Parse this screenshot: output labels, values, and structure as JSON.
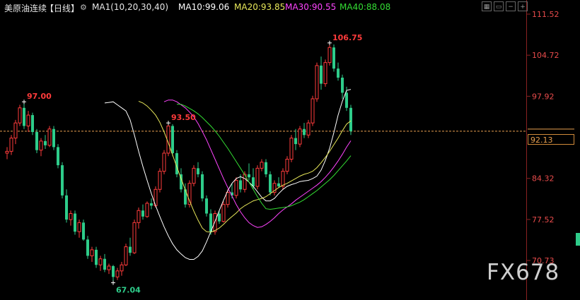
{
  "header": {
    "instrument": "美原油连续",
    "period": "【日线】",
    "settings_icon": "gear-icon",
    "ma_params": "MA1(10,20,30,40)",
    "ma10_label": "MA10:99.06",
    "ma20_label": "MA20:93.85",
    "ma30_label": "MA30:90.55",
    "ma40_label": "MA40:88.08"
  },
  "toolbar_icons": [
    "grid-icon",
    "window-icon",
    "minus-icon",
    "plus-icon"
  ],
  "watermark": "FX678",
  "colors": {
    "up": "#ff3b3b",
    "down": "#2ecc8a",
    "ma10": "#ffffff",
    "ma20": "#e8e85a",
    "ma30": "#ff44ff",
    "ma40": "#33dd33",
    "axis_text": "#e84b4b",
    "price_line": "#e8a050"
  },
  "chart_data": {
    "type": "candlestick",
    "title": "美原油连续【日线】",
    "ylim": [
      67.0,
      111.52
    ],
    "y_ticks": [
      "111.52",
      "104.72",
      "97.92",
      "92.13",
      "84.32",
      "77.52",
      "70.73"
    ],
    "current_price": "92.13",
    "annotations": [
      {
        "label": "97.00",
        "value": 97.0
      },
      {
        "label": "93.50",
        "value": 93.5
      },
      {
        "label": "106.75",
        "value": 106.75
      },
      {
        "label": "67.04",
        "value": 67.04
      }
    ],
    "ma_values": {
      "MA10": 99.06,
      "MA20": 93.85,
      "MA30": 90.55,
      "MA40": 88.08
    },
    "candles": [
      [
        88.5,
        89.5,
        87.5,
        88.8
      ],
      [
        88.8,
        91.5,
        88.2,
        91.0
      ],
      [
        91.0,
        94.0,
        90.0,
        93.5
      ],
      [
        93.5,
        96.5,
        93.0,
        96.0
      ],
      [
        96.0,
        97.0,
        92.5,
        93.0
      ],
      [
        93.0,
        95.5,
        92.0,
        94.8
      ],
      [
        94.8,
        95.2,
        91.5,
        92.0
      ],
      [
        92.0,
        92.5,
        88.5,
        89.0
      ],
      [
        89.0,
        91.0,
        88.0,
        90.5
      ],
      [
        90.5,
        91.5,
        89.2,
        89.8
      ],
      [
        89.8,
        93.0,
        89.5,
        92.5
      ],
      [
        92.5,
        93.0,
        89.0,
        89.5
      ],
      [
        89.5,
        90.0,
        86.0,
        86.5
      ],
      [
        86.5,
        87.0,
        81.0,
        81.5
      ],
      [
        81.5,
        82.5,
        77.0,
        77.5
      ],
      [
        77.5,
        79.0,
        76.5,
        78.5
      ],
      [
        78.5,
        79.0,
        75.0,
        75.5
      ],
      [
        75.5,
        77.5,
        74.5,
        77.0
      ],
      [
        77.0,
        77.5,
        74.0,
        74.2
      ],
      [
        74.2,
        74.8,
        71.0,
        71.5
      ],
      [
        71.5,
        73.0,
        70.5,
        72.5
      ],
      [
        72.5,
        73.0,
        69.5,
        70.0
      ],
      [
        70.0,
        71.5,
        69.0,
        71.0
      ],
      [
        71.0,
        71.8,
        68.8,
        69.2
      ],
      [
        69.2,
        70.2,
        68.5,
        69.8
      ],
      [
        69.8,
        70.0,
        67.04,
        68.0
      ],
      [
        68.0,
        69.5,
        67.5,
        69.0
      ],
      [
        69.0,
        70.5,
        68.2,
        70.0
      ],
      [
        70.0,
        73.5,
        69.8,
        73.0
      ],
      [
        73.0,
        74.5,
        71.5,
        72.0
      ],
      [
        72.0,
        77.5,
        71.8,
        77.0
      ],
      [
        77.0,
        79.5,
        76.0,
        79.0
      ],
      [
        79.0,
        80.0,
        77.5,
        78.0
      ],
      [
        78.0,
        80.5,
        77.8,
        80.2
      ],
      [
        80.2,
        81.0,
        79.2,
        79.8
      ],
      [
        79.8,
        83.0,
        79.5,
        82.5
      ],
      [
        82.5,
        86.0,
        82.0,
        85.5
      ],
      [
        85.5,
        89.0,
        85.0,
        88.5
      ],
      [
        88.5,
        93.5,
        88.0,
        93.0
      ],
      [
        93.0,
        93.3,
        88.0,
        88.5
      ],
      [
        88.5,
        89.0,
        84.5,
        85.0
      ],
      [
        85.0,
        86.0,
        82.0,
        82.5
      ],
      [
        82.5,
        83.5,
        79.5,
        80.0
      ],
      [
        80.0,
        84.0,
        79.5,
        83.5
      ],
      [
        83.5,
        86.5,
        83.0,
        86.0
      ],
      [
        86.0,
        87.0,
        84.5,
        85.0
      ],
      [
        85.0,
        85.5,
        80.5,
        81.0
      ],
      [
        81.0,
        81.5,
        78.0,
        78.5
      ],
      [
        78.5,
        79.2,
        75.0,
        75.5
      ],
      [
        75.5,
        79.0,
        75.0,
        78.5
      ],
      [
        78.5,
        79.0,
        76.8,
        77.2
      ],
      [
        77.2,
        80.5,
        77.0,
        80.0
      ],
      [
        80.0,
        82.5,
        79.5,
        82.0
      ],
      [
        82.0,
        83.5,
        81.0,
        81.5
      ],
      [
        81.5,
        84.5,
        81.0,
        84.0
      ],
      [
        84.0,
        85.0,
        82.0,
        82.5
      ],
      [
        82.5,
        85.5,
        82.0,
        85.0
      ],
      [
        85.0,
        86.8,
        84.0,
        84.5
      ],
      [
        84.5,
        86.0,
        82.5,
        83.0
      ],
      [
        83.0,
        86.5,
        82.5,
        86.0
      ],
      [
        86.0,
        87.5,
        85.5,
        87.0
      ],
      [
        87.0,
        87.5,
        84.5,
        85.0
      ],
      [
        85.0,
        85.5,
        81.5,
        82.0
      ],
      [
        82.0,
        84.0,
        81.5,
        83.5
      ],
      [
        83.5,
        84.5,
        82.8,
        83.0
      ],
      [
        83.0,
        86.0,
        82.5,
        85.5
      ],
      [
        85.5,
        88.0,
        85.0,
        87.5
      ],
      [
        87.5,
        91.5,
        87.0,
        91.0
      ],
      [
        91.0,
        92.5,
        89.0,
        90.0
      ],
      [
        90.0,
        93.0,
        89.5,
        92.5
      ],
      [
        92.5,
        93.5,
        91.0,
        91.5
      ],
      [
        91.5,
        94.0,
        91.0,
        93.5
      ],
      [
        93.5,
        98.0,
        93.0,
        97.5
      ],
      [
        97.5,
        103.5,
        97.0,
        103.0
      ],
      [
        103.0,
        104.5,
        99.0,
        100.0
      ],
      [
        100.0,
        104.0,
        99.5,
        103.5
      ],
      [
        103.5,
        106.75,
        103.0,
        106.0
      ],
      [
        106.0,
        106.5,
        102.0,
        102.5
      ],
      [
        102.5,
        103.5,
        100.5,
        101.0
      ],
      [
        101.0,
        101.5,
        97.5,
        98.5
      ],
      [
        98.5,
        99.5,
        95.5,
        96.0
      ],
      [
        96.0,
        96.5,
        91.5,
        92.13
      ]
    ],
    "moving_averages": {
      "MA10": [
        96.8,
        96.9,
        97.0,
        96.5,
        96.0,
        95.5,
        94.0,
        91.5,
        88.8,
        86.3,
        84.0,
        81.8,
        79.8,
        78.0,
        76.3,
        74.8,
        73.5,
        72.5,
        71.8,
        71.2,
        70.9,
        70.9,
        71.4,
        72.3,
        73.8,
        75.5,
        77.2,
        79.0,
        80.7,
        82.3,
        83.5,
        84.3,
        84.6,
        84.3,
        83.7,
        83.0,
        82.1,
        81.2,
        80.6,
        80.6,
        81.0,
        81.8,
        82.5,
        83.0,
        83.3,
        83.5,
        83.8,
        83.9,
        84.0,
        84.3,
        84.7,
        85.7,
        87.3,
        89.3,
        91.9,
        94.8,
        97.1,
        98.9,
        99.06
      ],
      "MA20": [
        97.1,
        96.8,
        96.3,
        95.6,
        94.8,
        93.6,
        92.0,
        90.2,
        88.2,
        86.2,
        84.3,
        82.4,
        80.6,
        78.9,
        77.4,
        76.1,
        75.5,
        75.4,
        75.7,
        76.1,
        76.7,
        77.4,
        78.0,
        78.6,
        79.3,
        79.8,
        80.2,
        80.6,
        80.8,
        81.0,
        81.3,
        81.8,
        82.3,
        82.8,
        83.2,
        83.5,
        83.9,
        84.3,
        84.7,
        85.0,
        85.2,
        85.5,
        86.1,
        86.9,
        87.8,
        88.8,
        89.9,
        91.0,
        92.2,
        93.3,
        93.85
      ],
      "MA30": [
        97.0,
        97.3,
        97.3,
        97.0,
        96.5,
        96.0,
        95.3,
        94.5,
        93.4,
        92.1,
        90.7,
        89.1,
        87.5,
        85.9,
        84.3,
        82.8,
        81.4,
        80.0,
        78.8,
        77.8,
        77.0,
        76.5,
        76.2,
        76.3,
        76.7,
        77.2,
        77.8,
        78.5,
        79.1,
        79.6,
        80.1,
        80.7,
        81.2,
        81.7,
        82.2,
        82.7,
        83.2,
        83.8,
        84.5,
        85.3,
        86.2,
        87.2,
        88.3,
        89.5,
        90.55
      ],
      "MA40": [
        96.6,
        96.6,
        96.3,
        95.9,
        95.5,
        95.0,
        94.4,
        93.7,
        93.0,
        92.2,
        91.3,
        90.3,
        89.3,
        88.2,
        87.1,
        86.0,
        84.9,
        83.7,
        82.5,
        81.3,
        80.2,
        79.3,
        79.2,
        79.3,
        79.4,
        79.5,
        79.6,
        79.8,
        80.1,
        80.4,
        80.8,
        81.3,
        81.8,
        82.3,
        82.9,
        83.5,
        84.1,
        84.8,
        85.6,
        86.4,
        87.2,
        88.08
      ]
    }
  }
}
